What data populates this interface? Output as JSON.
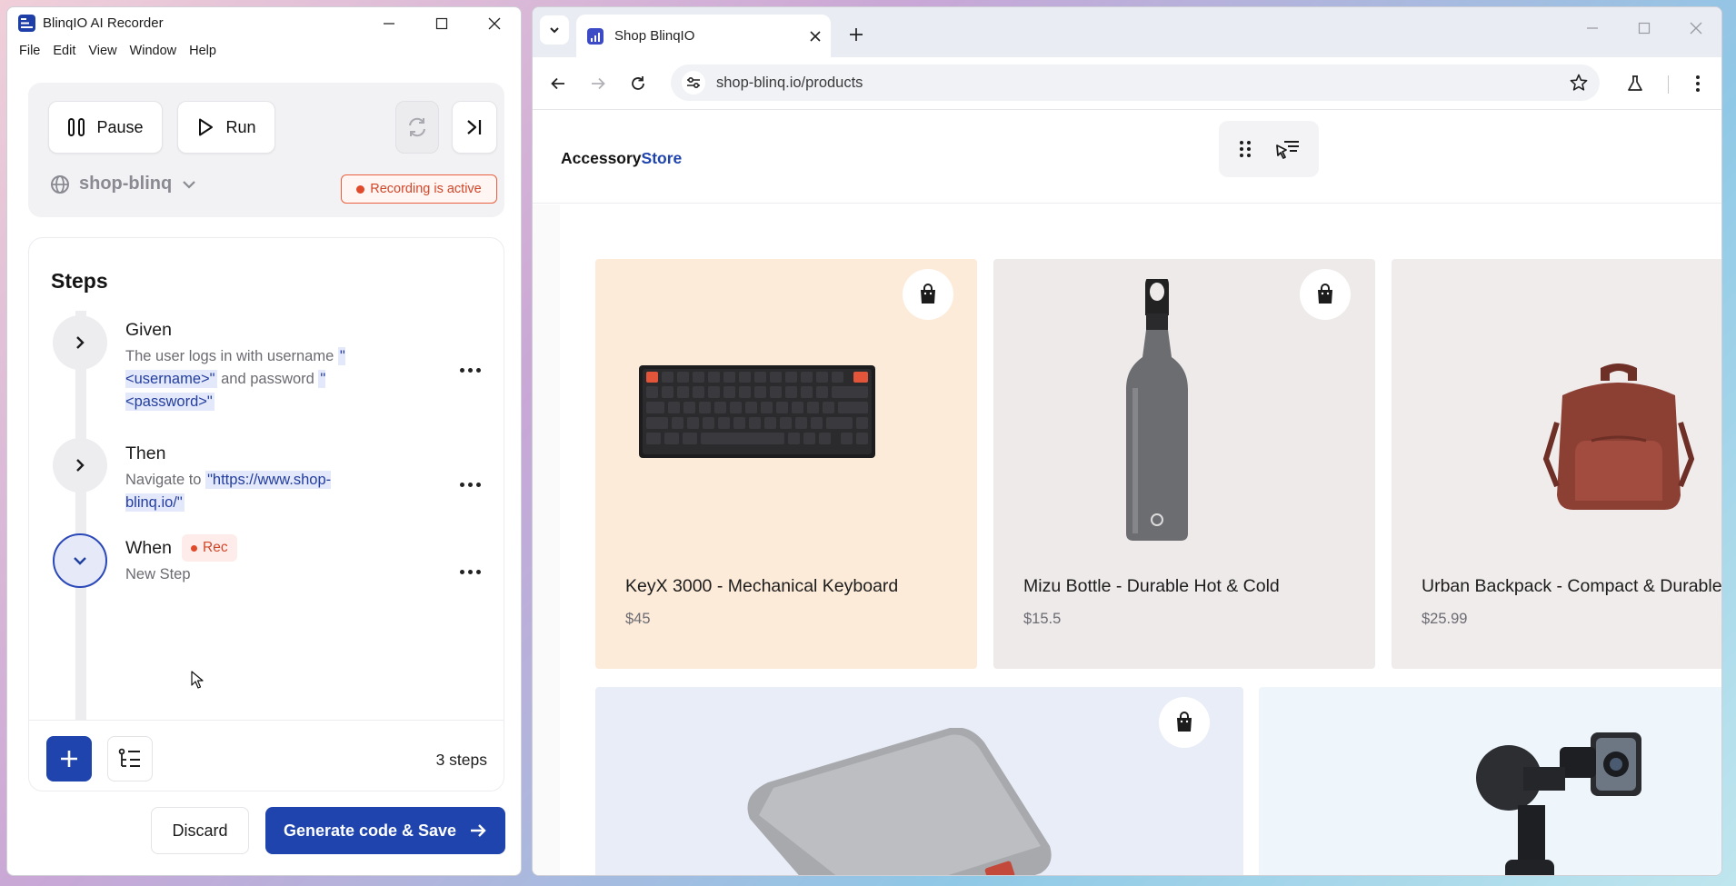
{
  "recorder": {
    "title": "BlinqIO AI Recorder",
    "menu": [
      "File",
      "Edit",
      "View",
      "Window",
      "Help"
    ],
    "controls": {
      "pause": "Pause",
      "run": "Run"
    },
    "project": "shop-blinq",
    "recording_status": "Recording is active",
    "steps_heading": "Steps",
    "steps": [
      {
        "keyword": "Given",
        "text_parts": [
          "The user logs in with username ",
          "\"<username>\"",
          " and password ",
          "\"<password>\""
        ]
      },
      {
        "keyword": "Then",
        "text_parts": [
          "Navigate to ",
          "\"https://www.shop-blinq.io/\""
        ]
      },
      {
        "keyword": "When",
        "badge": "Rec",
        "text": "New Step"
      }
    ],
    "steps_count": "3 steps",
    "discard": "Discard",
    "generate": "Generate code & Save"
  },
  "browser": {
    "tab_title": "Shop BlinqIO",
    "url": "shop-blinq.io/products",
    "site": {
      "logo_main": "Accessory",
      "logo_accent": "Store"
    },
    "products": [
      {
        "name": "KeyX 3000 - Mechanical Keyboard",
        "price": "$45"
      },
      {
        "name": "Mizu Bottle - Durable Hot & Cold",
        "price": "$15.5"
      },
      {
        "name": "Urban Backpack - Compact & Durable",
        "price": "$25.99"
      }
    ]
  },
  "icons": {
    "recorder": [
      "app-logo-icon",
      "minimize-icon",
      "maximize-icon",
      "close-icon",
      "pause-icon",
      "play-icon",
      "refresh-icon",
      "skip-to-end-icon",
      "globe-icon",
      "chevron-down-icon",
      "chevron-right-icon",
      "more-icon",
      "plus-icon",
      "list-icon",
      "arrow-right-icon",
      "cursor-icon"
    ],
    "browser": [
      "tab-dropdown-icon",
      "favicon-icon",
      "close-tab-icon",
      "new-tab-icon",
      "back-icon",
      "forward-icon",
      "reload-icon",
      "site-info-icon",
      "bookmark-star-icon",
      "labs-flask-icon",
      "kebab-menu-icon",
      "grid-view-icon",
      "pointer-view-icon",
      "shopping-bag-icon"
    ]
  },
  "colors": {
    "brand_blue": "#1f44ad",
    "recording_red": "#e04a2a",
    "param_bg": "#e3e9fb"
  }
}
